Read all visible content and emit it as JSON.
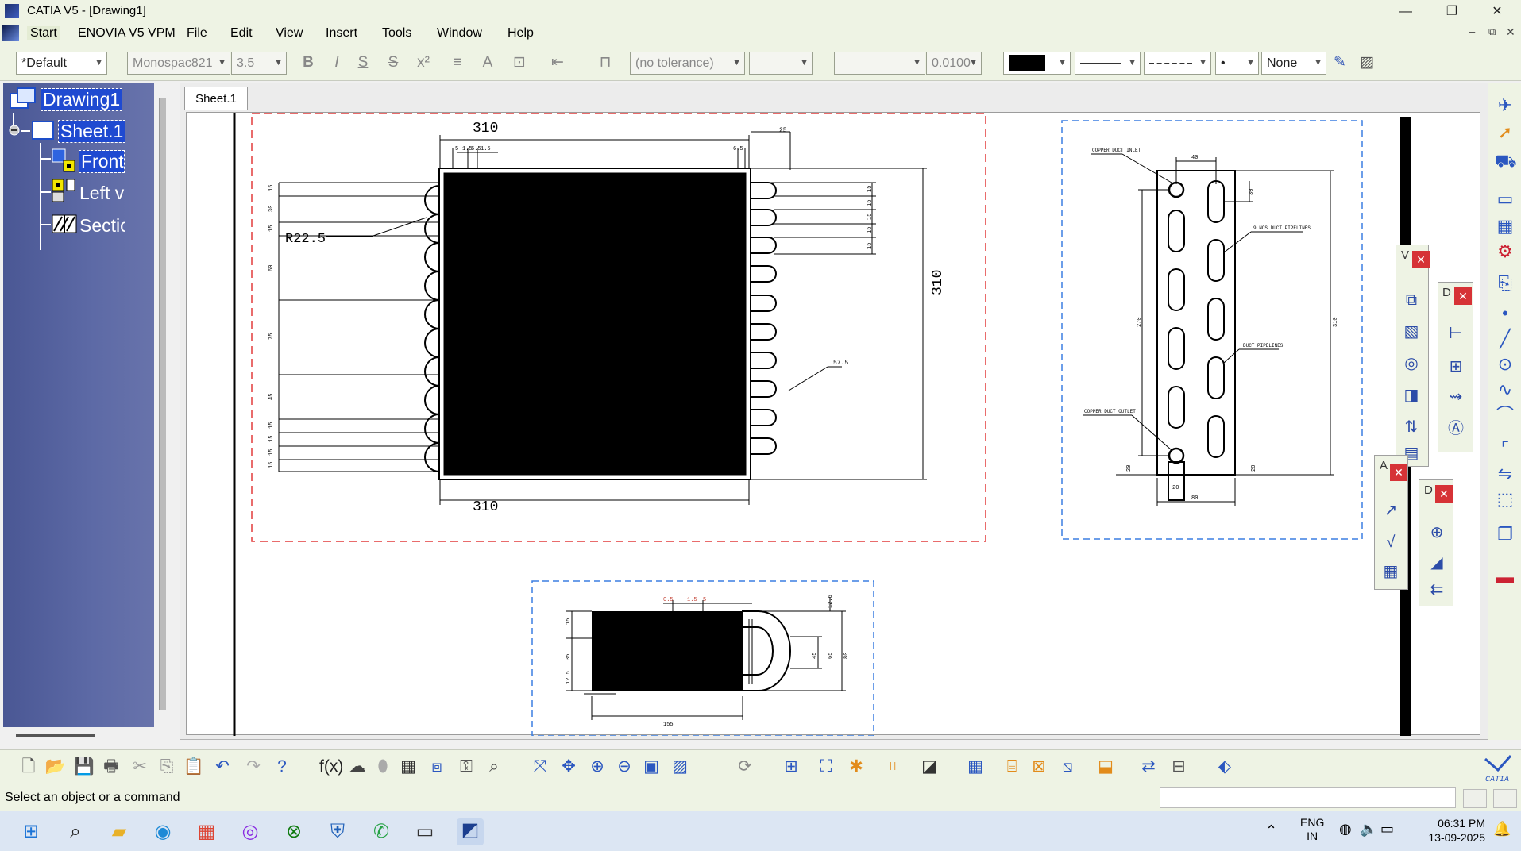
{
  "window": {
    "title": "CATIA V5 - [Drawing1]",
    "controls": {
      "minimize": "—",
      "maximize": "❐",
      "close": "✕"
    }
  },
  "menu": {
    "items": [
      "Start",
      "ENOVIA V5 VPM",
      "File",
      "Edit",
      "View",
      "Insert",
      "Tools",
      "Window",
      "Help"
    ]
  },
  "toolbar_text": {
    "style_combo": "*Default",
    "font_combo": "Monospac821",
    "size_combo": "3.5",
    "tolerance_combo": "(no tolerance)",
    "precision_combo": "0.0100",
    "pattern_combo": "None"
  },
  "tree": {
    "root": "Drawing1",
    "sheet": "Sheet.1",
    "views": [
      "Front view",
      "Left view",
      "Section view"
    ]
  },
  "sheet_tab": "Sheet.1",
  "drawing": {
    "front_view": {
      "top_width": "310",
      "bottom_width": "310",
      "height": "310",
      "radius_note": "R22.5",
      "small_top_right": "25",
      "small_top": [
        "5",
        "1.5",
        "6.5",
        "1.5"
      ],
      "small_top_right2": "6.5",
      "right_leader": "57.5",
      "left_dims": [
        "15",
        "30",
        "15",
        "60",
        "75",
        "45",
        "15",
        "15",
        "15",
        "15"
      ],
      "right_dims": [
        "15",
        "15",
        "15",
        "15",
        "15"
      ]
    },
    "left_view": {
      "inlet": "COPPER DUCT INLET",
      "pipelines_top": "9 NOS DUCT PIPELINES",
      "pipelines": "DUCT PIPELINES",
      "outlet": "COPPER DUCT OUTLET",
      "top_dim": "40",
      "right_small": "30",
      "left_height": "270",
      "right_height": "310",
      "bottom_left": "20",
      "bottom_right": "20",
      "bottom_width": "80",
      "bottom_small": "20"
    },
    "section_view": {
      "top_small": [
        "0.5",
        "1.5",
        "5"
      ],
      "right_top": "12.5",
      "left_dims": [
        "15",
        "35",
        "12.5"
      ],
      "right_dims": [
        "45",
        "65",
        "80"
      ],
      "bottom_width": "155"
    }
  },
  "floating_toolbars": {
    "views_title": "V",
    "dimensioning_title": "D",
    "annotations_title": "A",
    "dress_title": "D"
  },
  "status": {
    "message": "Select an object or a command"
  },
  "taskbar": {
    "lang_top": "ENG",
    "lang_bottom": "IN",
    "time": "06:31 PM",
    "date": "13-09-2025"
  }
}
